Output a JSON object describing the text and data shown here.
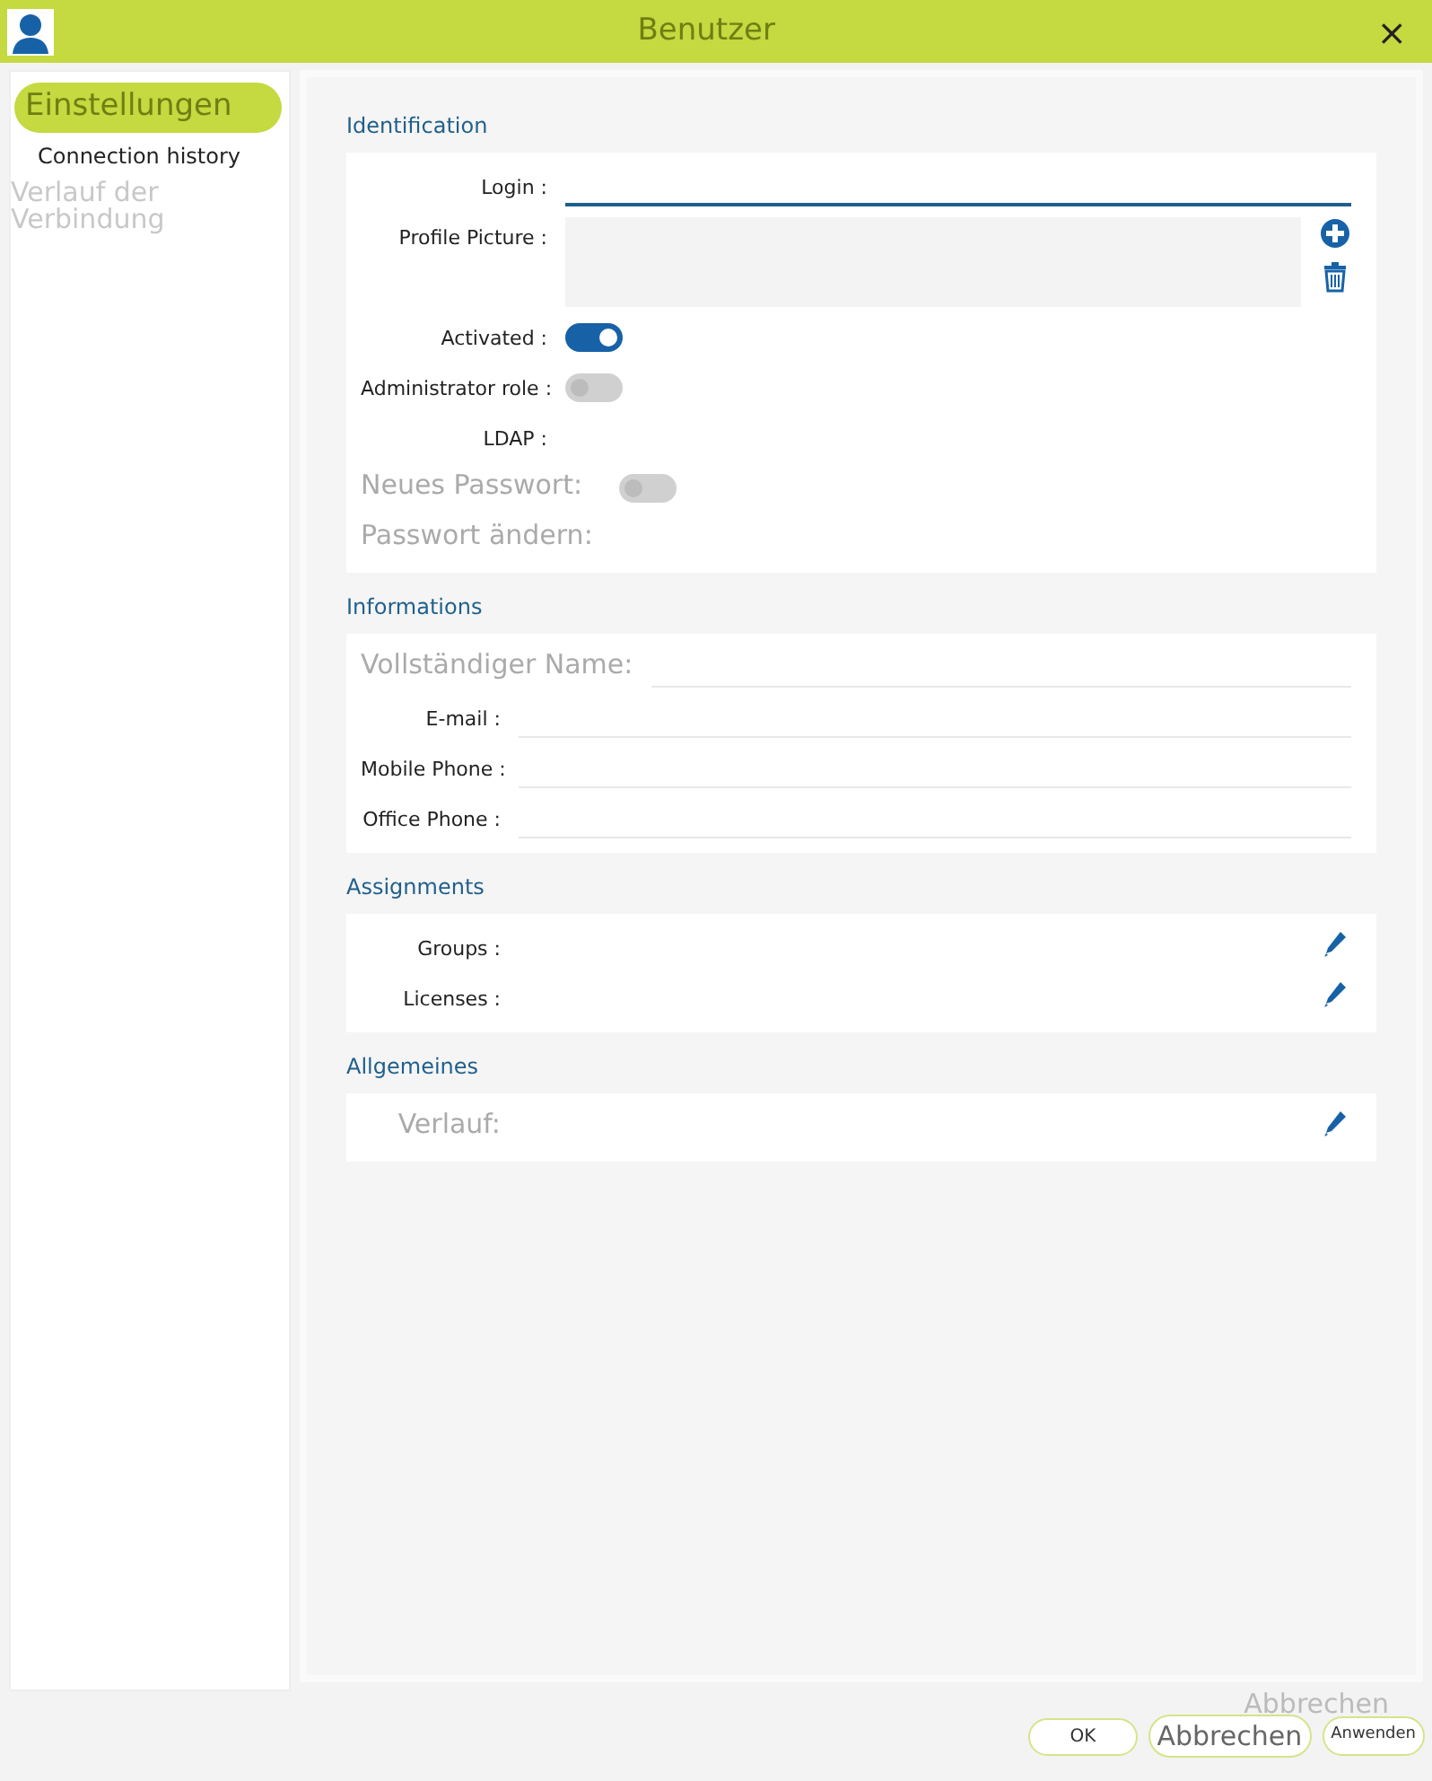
{
  "window": {
    "title": "Benutzer",
    "close": "×"
  },
  "sidebar": {
    "items": [
      {
        "label": "Einstellungen",
        "selected": true
      },
      {
        "label": "Connection history",
        "selected": false,
        "note": "Verlauf der Verbindung"
      }
    ]
  },
  "sections": [
    {
      "title": "Identification",
      "fields": [
        {
          "kind": "text",
          "label": "Login :",
          "focused": true
        },
        {
          "kind": "picture",
          "label": "Profile Picture :"
        },
        {
          "kind": "toggle",
          "label": "Activated :",
          "on": true,
          "disabled": false
        },
        {
          "kind": "toggle",
          "label": "Administrator role :",
          "on": false,
          "disabled": true
        },
        {
          "kind": "plain",
          "label": "LDAP :"
        },
        {
          "kind": "toggle",
          "label": "Neues Passwort:",
          "on": false,
          "disabled": true
        },
        {
          "kind": "plain",
          "label": "Passwort ändern:"
        }
      ]
    },
    {
      "title": "Informations",
      "fields": [
        {
          "kind": "text",
          "label": "Vollständiger Name:",
          "focused": false
        },
        {
          "kind": "text",
          "label": "E-mail :",
          "focused": false
        },
        {
          "kind": "text",
          "label": "Mobile Phone :",
          "focused": false
        },
        {
          "kind": "text",
          "label": "Office Phone :",
          "focused": false
        }
      ]
    },
    {
      "title": "Assignments",
      "fields": [
        {
          "kind": "edit",
          "label": "Groups :"
        },
        {
          "kind": "edit",
          "label": "Licenses :"
        }
      ]
    },
    {
      "title": "Allgemeines",
      "fields": [
        {
          "kind": "edit",
          "label": "Verlauf:"
        }
      ]
    }
  ],
  "footer": {
    "hint": "Abbrechen",
    "buttons": [
      "OK",
      "Abbrechen",
      "Anwenden"
    ]
  }
}
